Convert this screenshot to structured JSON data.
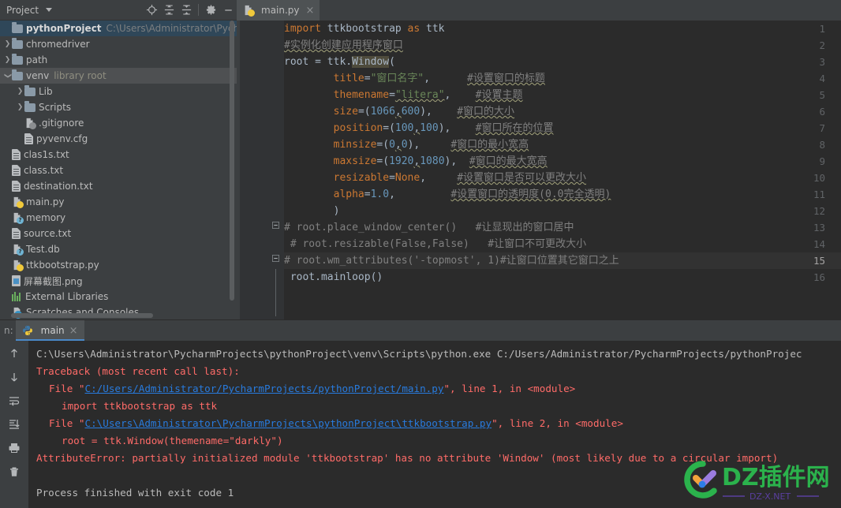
{
  "colors": {
    "panel_bg": "#3c3f41",
    "editor_bg": "#2b2b2b",
    "selection_blue": "#2f4759",
    "accent_blue": "#4a88c7",
    "error_red": "#ff6b68",
    "link_blue": "#287bde",
    "keyword_orange": "#cc7832",
    "string_green": "#6a8759",
    "number_blue": "#6897bb",
    "comment_gray": "#808080",
    "constant_purple": "#9876aa"
  },
  "project_panel": {
    "title": "Project",
    "header_icons": [
      {
        "name": "locate-target-icon",
        "glyph": "target"
      },
      {
        "name": "expand-all-icon",
        "glyph": "expand"
      },
      {
        "name": "collapse-all-icon",
        "glyph": "collapse"
      },
      {
        "name": "settings-gear-icon",
        "glyph": "gear"
      },
      {
        "name": "minimize-icon",
        "glyph": "minus"
      }
    ],
    "tree": [
      {
        "label": "pythonProject",
        "sub": "C:\\Users\\Administrator\\PycharmP",
        "icon": "folder",
        "indent": 0,
        "arrow": "",
        "state": "selected",
        "bold": true
      },
      {
        "label": "chromedriver",
        "sub": "",
        "icon": "folder",
        "indent": 0,
        "arrow": "collapsed",
        "state": "",
        "bold": false
      },
      {
        "label": "path",
        "sub": "",
        "icon": "folder",
        "indent": 0,
        "arrow": "collapsed",
        "state": "",
        "bold": false
      },
      {
        "label": "venv",
        "sub": "library root",
        "icon": "folder",
        "indent": 0,
        "arrow": "expanded",
        "state": "hovered",
        "bold": false
      },
      {
        "label": "Lib",
        "sub": "",
        "icon": "folder",
        "indent": 1,
        "arrow": "collapsed",
        "state": "",
        "bold": false
      },
      {
        "label": "Scripts",
        "sub": "",
        "icon": "folder",
        "indent": 1,
        "arrow": "collapsed",
        "state": "",
        "bold": false
      },
      {
        "label": ".gitignore",
        "sub": "",
        "icon": "file-ignored",
        "indent": 1,
        "arrow": "",
        "state": "",
        "bold": false
      },
      {
        "label": "pyvenv.cfg",
        "sub": "",
        "icon": "file-text",
        "indent": 1,
        "arrow": "",
        "state": "",
        "bold": false
      },
      {
        "label": "clas1s.txt",
        "sub": "",
        "icon": "file-text",
        "indent": 0,
        "arrow": "",
        "state": "",
        "bold": false
      },
      {
        "label": "class.txt",
        "sub": "",
        "icon": "file-text",
        "indent": 0,
        "arrow": "",
        "state": "",
        "bold": false
      },
      {
        "label": "destination.txt",
        "sub": "",
        "icon": "file-text",
        "indent": 0,
        "arrow": "",
        "state": "",
        "bold": false
      },
      {
        "label": "main.py",
        "sub": "",
        "icon": "file-python",
        "indent": 0,
        "arrow": "",
        "state": "",
        "bold": false
      },
      {
        "label": "memory",
        "sub": "",
        "icon": "file-unknown",
        "indent": 0,
        "arrow": "",
        "state": "",
        "bold": false
      },
      {
        "label": "source.txt",
        "sub": "",
        "icon": "file-text",
        "indent": 0,
        "arrow": "",
        "state": "",
        "bold": false
      },
      {
        "label": "Test.db",
        "sub": "",
        "icon": "file-unknown",
        "indent": 0,
        "arrow": "",
        "state": "",
        "bold": false
      },
      {
        "label": "ttkbootstrap.py",
        "sub": "",
        "icon": "file-python",
        "indent": 0,
        "arrow": "",
        "state": "",
        "bold": false
      },
      {
        "label": "屏幕截图.png",
        "sub": "",
        "icon": "file-image",
        "indent": 0,
        "arrow": "",
        "state": "",
        "bold": false
      },
      {
        "label": "External Libraries",
        "sub": "",
        "icon": "external-libraries",
        "indent": 0,
        "arrow": "",
        "state": "",
        "bold": false
      },
      {
        "label": "Scratches and Consoles",
        "sub": "",
        "icon": "scratches",
        "indent": 0,
        "arrow": "",
        "state": "",
        "bold": false
      }
    ]
  },
  "editor": {
    "tab": {
      "name": "main.py",
      "close": "×",
      "icon": "python-file-icon"
    },
    "current_line": 15,
    "lines": [
      {
        "n": 1,
        "fold": "",
        "segments": [
          {
            "t": "import ",
            "c": "kw"
          },
          {
            "t": "ttkbootstrap ",
            "c": "plain"
          },
          {
            "t": "as ",
            "c": "kw"
          },
          {
            "t": "ttk",
            "c": "plain"
          }
        ]
      },
      {
        "n": 2,
        "fold": "",
        "segments": [
          {
            "t": "#实例化创建应用程序窗口",
            "c": "cmt squig"
          }
        ]
      },
      {
        "n": 3,
        "fold": "",
        "segments": [
          {
            "t": "root = ttk.",
            "c": "plain"
          },
          {
            "t": "Window",
            "c": "id-hl"
          },
          {
            "t": "(",
            "c": "plain"
          }
        ]
      },
      {
        "n": 4,
        "fold": "",
        "segments": [
          {
            "t": "        ",
            "c": "plain"
          },
          {
            "t": "title",
            "c": "param"
          },
          {
            "t": "=",
            "c": "plain"
          },
          {
            "t": "\"窗口名字\"",
            "c": "str"
          },
          {
            "t": ",",
            "c": "plain"
          },
          {
            "t": "      ",
            "c": "plain"
          },
          {
            "t": "#设置窗口的标题",
            "c": "cmt squig"
          }
        ]
      },
      {
        "n": 5,
        "fold": "",
        "segments": [
          {
            "t": "        ",
            "c": "plain"
          },
          {
            "t": "themename",
            "c": "param"
          },
          {
            "t": "=",
            "c": "plain"
          },
          {
            "t": "\"litera\"",
            "c": "str squig"
          },
          {
            "t": ",",
            "c": "plain"
          },
          {
            "t": "    ",
            "c": "plain"
          },
          {
            "t": "#设置主题",
            "c": "cmt squig"
          }
        ]
      },
      {
        "n": 6,
        "fold": "",
        "segments": [
          {
            "t": "        ",
            "c": "plain"
          },
          {
            "t": "size",
            "c": "param"
          },
          {
            "t": "=(",
            "c": "plain"
          },
          {
            "t": "1066",
            "c": "num"
          },
          {
            "t": ",",
            "c": "plain squig"
          },
          {
            "t": "600",
            "c": "num"
          },
          {
            "t": "),",
            "c": "plain"
          },
          {
            "t": "    ",
            "c": "plain"
          },
          {
            "t": "#窗口的大小",
            "c": "cmt squig"
          }
        ]
      },
      {
        "n": 7,
        "fold": "",
        "segments": [
          {
            "t": "        ",
            "c": "plain"
          },
          {
            "t": "position",
            "c": "param"
          },
          {
            "t": "=(",
            "c": "plain"
          },
          {
            "t": "100",
            "c": "num"
          },
          {
            "t": ",",
            "c": "plain squig"
          },
          {
            "t": "100",
            "c": "num"
          },
          {
            "t": "),",
            "c": "plain"
          },
          {
            "t": "    ",
            "c": "plain"
          },
          {
            "t": "#窗口所在的位置",
            "c": "cmt squig"
          }
        ]
      },
      {
        "n": 8,
        "fold": "",
        "segments": [
          {
            "t": "        ",
            "c": "plain"
          },
          {
            "t": "minsize",
            "c": "param"
          },
          {
            "t": "=(",
            "c": "plain"
          },
          {
            "t": "0",
            "c": "num"
          },
          {
            "t": ",",
            "c": "plain squig"
          },
          {
            "t": "0",
            "c": "num"
          },
          {
            "t": "),",
            "c": "plain"
          },
          {
            "t": "     ",
            "c": "plain"
          },
          {
            "t": "#窗口的最小宽高",
            "c": "cmt squig"
          }
        ]
      },
      {
        "n": 9,
        "fold": "",
        "segments": [
          {
            "t": "        ",
            "c": "plain"
          },
          {
            "t": "maxsize",
            "c": "param"
          },
          {
            "t": "=(",
            "c": "plain"
          },
          {
            "t": "1920",
            "c": "num"
          },
          {
            "t": ",",
            "c": "plain squig"
          },
          {
            "t": "1080",
            "c": "num"
          },
          {
            "t": "),",
            "c": "plain"
          },
          {
            "t": "  ",
            "c": "plain"
          },
          {
            "t": "#窗口的最大宽高",
            "c": "cmt squig"
          }
        ]
      },
      {
        "n": 10,
        "fold": "",
        "segments": [
          {
            "t": "        ",
            "c": "plain"
          },
          {
            "t": "resizable",
            "c": "param"
          },
          {
            "t": "=",
            "c": "plain"
          },
          {
            "t": "None",
            "c": "kw"
          },
          {
            "t": ",",
            "c": "plain"
          },
          {
            "t": "     ",
            "c": "plain"
          },
          {
            "t": "#设置窗口是否可以更改大小",
            "c": "cmt squig"
          }
        ]
      },
      {
        "n": 11,
        "fold": "",
        "segments": [
          {
            "t": "        ",
            "c": "plain"
          },
          {
            "t": "alpha",
            "c": "param"
          },
          {
            "t": "=",
            "c": "plain"
          },
          {
            "t": "1.0",
            "c": "num"
          },
          {
            "t": ",",
            "c": "plain"
          },
          {
            "t": "         ",
            "c": "plain"
          },
          {
            "t": "#设置窗口的透明度(0.0完全透明)",
            "c": "cmt squig"
          }
        ]
      },
      {
        "n": 12,
        "fold": "",
        "segments": [
          {
            "t": "        )",
            "c": "plain"
          }
        ]
      },
      {
        "n": 13,
        "fold": "minus",
        "segments": [
          {
            "t": "# root.place_window_center()",
            "c": "cmt"
          },
          {
            "t": "   ",
            "c": "plain"
          },
          {
            "t": "#让显现出的窗口居中",
            "c": "cmt"
          }
        ]
      },
      {
        "n": 14,
        "fold": "",
        "segments": [
          {
            "t": " # root.resizable(False,False)",
            "c": "cmt"
          },
          {
            "t": "   ",
            "c": "plain"
          },
          {
            "t": "#让窗口不可更改大小",
            "c": "cmt"
          }
        ]
      },
      {
        "n": 15,
        "fold": "minus",
        "segments": [
          {
            "t": "# root.wm_attributes('-topmost', 1)#让窗口位置其它窗口之上",
            "c": "cmt"
          }
        ]
      },
      {
        "n": 16,
        "fold": "",
        "segments": [
          {
            "t": " root.mainloop()",
            "c": "plain"
          }
        ]
      }
    ]
  },
  "run_panel": {
    "label": "n:",
    "tab": {
      "name": "main",
      "close": "×",
      "icon": "python-run-icon"
    },
    "toolbar_icons": [
      {
        "name": "scroll-up-icon",
        "glyph": "↑"
      },
      {
        "name": "scroll-down-icon",
        "glyph": "↓"
      },
      {
        "name": "soft-wrap-icon",
        "glyph": "wrap"
      },
      {
        "name": "scroll-to-end-icon",
        "glyph": "end"
      },
      {
        "name": "print-icon",
        "glyph": "printer"
      },
      {
        "name": "clear-all-icon",
        "glyph": "trash"
      }
    ],
    "console_lines": [
      {
        "indent": 0,
        "segments": [
          {
            "t": "C:\\Users\\Administrator\\PycharmProjects\\pythonProject\\venv\\Scripts\\python.exe C:/Users/Administrator/PycharmProjects/pythonProjec",
            "c": "c-white"
          }
        ]
      },
      {
        "indent": 0,
        "segments": [
          {
            "t": "Traceback (most recent call last):",
            "c": "c-red"
          }
        ]
      },
      {
        "indent": 1,
        "segments": [
          {
            "t": "File \"",
            "c": "c-red"
          },
          {
            "t": "C:/Users/Administrator/PycharmProjects/pythonProject/main.py",
            "c": "c-link"
          },
          {
            "t": "\", line 1, in <module>",
            "c": "c-red"
          }
        ]
      },
      {
        "indent": 2,
        "segments": [
          {
            "t": "import ttkbootstrap as ttk",
            "c": "c-red"
          }
        ]
      },
      {
        "indent": 1,
        "segments": [
          {
            "t": "File \"",
            "c": "c-red"
          },
          {
            "t": "C:\\Users\\Administrator\\PycharmProjects\\pythonProject\\ttkbootstrap.py",
            "c": "c-link"
          },
          {
            "t": "\", line 2, in <module>",
            "c": "c-red"
          }
        ]
      },
      {
        "indent": 2,
        "segments": [
          {
            "t": "root = ttk.Window(themename=\"darkly\")",
            "c": "c-red"
          }
        ]
      },
      {
        "indent": 0,
        "segments": [
          {
            "t": "AttributeError: partially initialized module 'ttkbootstrap' has no attribute 'Window' (most likely due to a circular import)",
            "c": "c-red"
          }
        ]
      },
      {
        "indent": 0,
        "segments": []
      },
      {
        "indent": 0,
        "segments": [
          {
            "t": "Process finished with exit code 1",
            "c": "c-white"
          }
        ]
      }
    ]
  },
  "watermark": {
    "text": "DZ插件网",
    "subtitle": "DZ-X.NET",
    "brand_green": "#2bb24c",
    "accent_orange": "#f2a33c",
    "accent_purple": "#9b7ce0",
    "accent_blue": "#2d7ee8"
  }
}
